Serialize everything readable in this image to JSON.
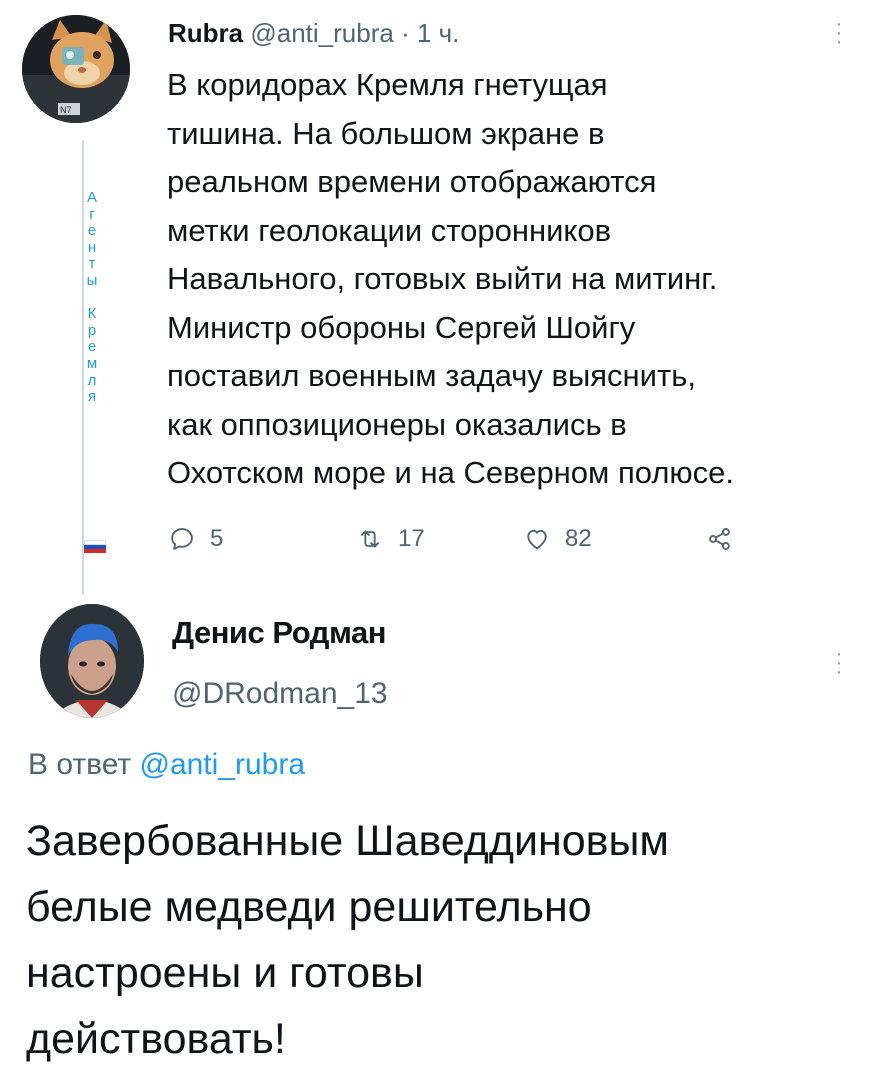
{
  "tweet": {
    "author_name": "Rubra",
    "author_handle": "@anti_rubra",
    "separator": " · ",
    "time": "1 ч.",
    "thread_label_chars": [
      "А",
      "г",
      "е",
      "н",
      "т",
      "ы",
      "",
      "К",
      "р",
      "е",
      "м",
      "л",
      "я"
    ],
    "body_lines": [
      "В коридорах Кремля гнетущая",
      "тишина. На большом экране в",
      "реальном времени отображаются",
      "метки геолокации сторонников",
      "Навального, готовых выйти на митинг.",
      "Министр обороны Сергей Шойгу",
      "поставил военным задачу выяснить,",
      "как оппозиционеры оказались в",
      "Охотском море и на Северном полюсе."
    ],
    "actions": {
      "reply_count": "5",
      "retweet_count": "17",
      "like_count": "82"
    },
    "colors": {
      "accent": "#1d9bf0",
      "secondary_text": "#536471",
      "thread_line": "#cfd9de"
    }
  },
  "reply": {
    "author_name": "Денис Родман",
    "author_handle": "@DRodman_13",
    "reply_prefix": "В ответ ",
    "reply_mention": "@anti_rubra",
    "body_lines": [
      "Завербованные Шаведдиновым",
      "белые медведи решительно",
      "настроены и готовы",
      "действовать!"
    ]
  },
  "icons": [
    "more-vertical-icon",
    "reply-icon",
    "retweet-icon",
    "like-icon",
    "share-icon",
    "flag-icon"
  ]
}
